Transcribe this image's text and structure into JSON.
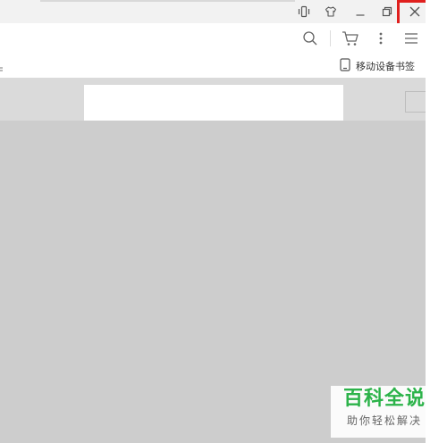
{
  "window_controls": {
    "items": [
      {
        "name": "phone-sync-icon"
      },
      {
        "name": "skin-icon"
      },
      {
        "name": "minimize-icon"
      },
      {
        "name": "restore-icon"
      },
      {
        "name": "close-icon"
      }
    ],
    "highlight_color": "#e0201e"
  },
  "toolbar": {
    "icons": [
      "search-icon",
      "cart-icon",
      "more-vertical-icon",
      "menu-icon"
    ]
  },
  "bookmarks_bar": {
    "mobile_bookmarks_label": "移动设备书签"
  },
  "watermark": {
    "title": "百科全说",
    "subtitle": "助你轻松解决",
    "title_color": "#2cb34a"
  },
  "colors": {
    "content_bg": "#cdcdcd",
    "header_bg": "#dadada",
    "titlebar_bg": "#f2f2f2"
  }
}
